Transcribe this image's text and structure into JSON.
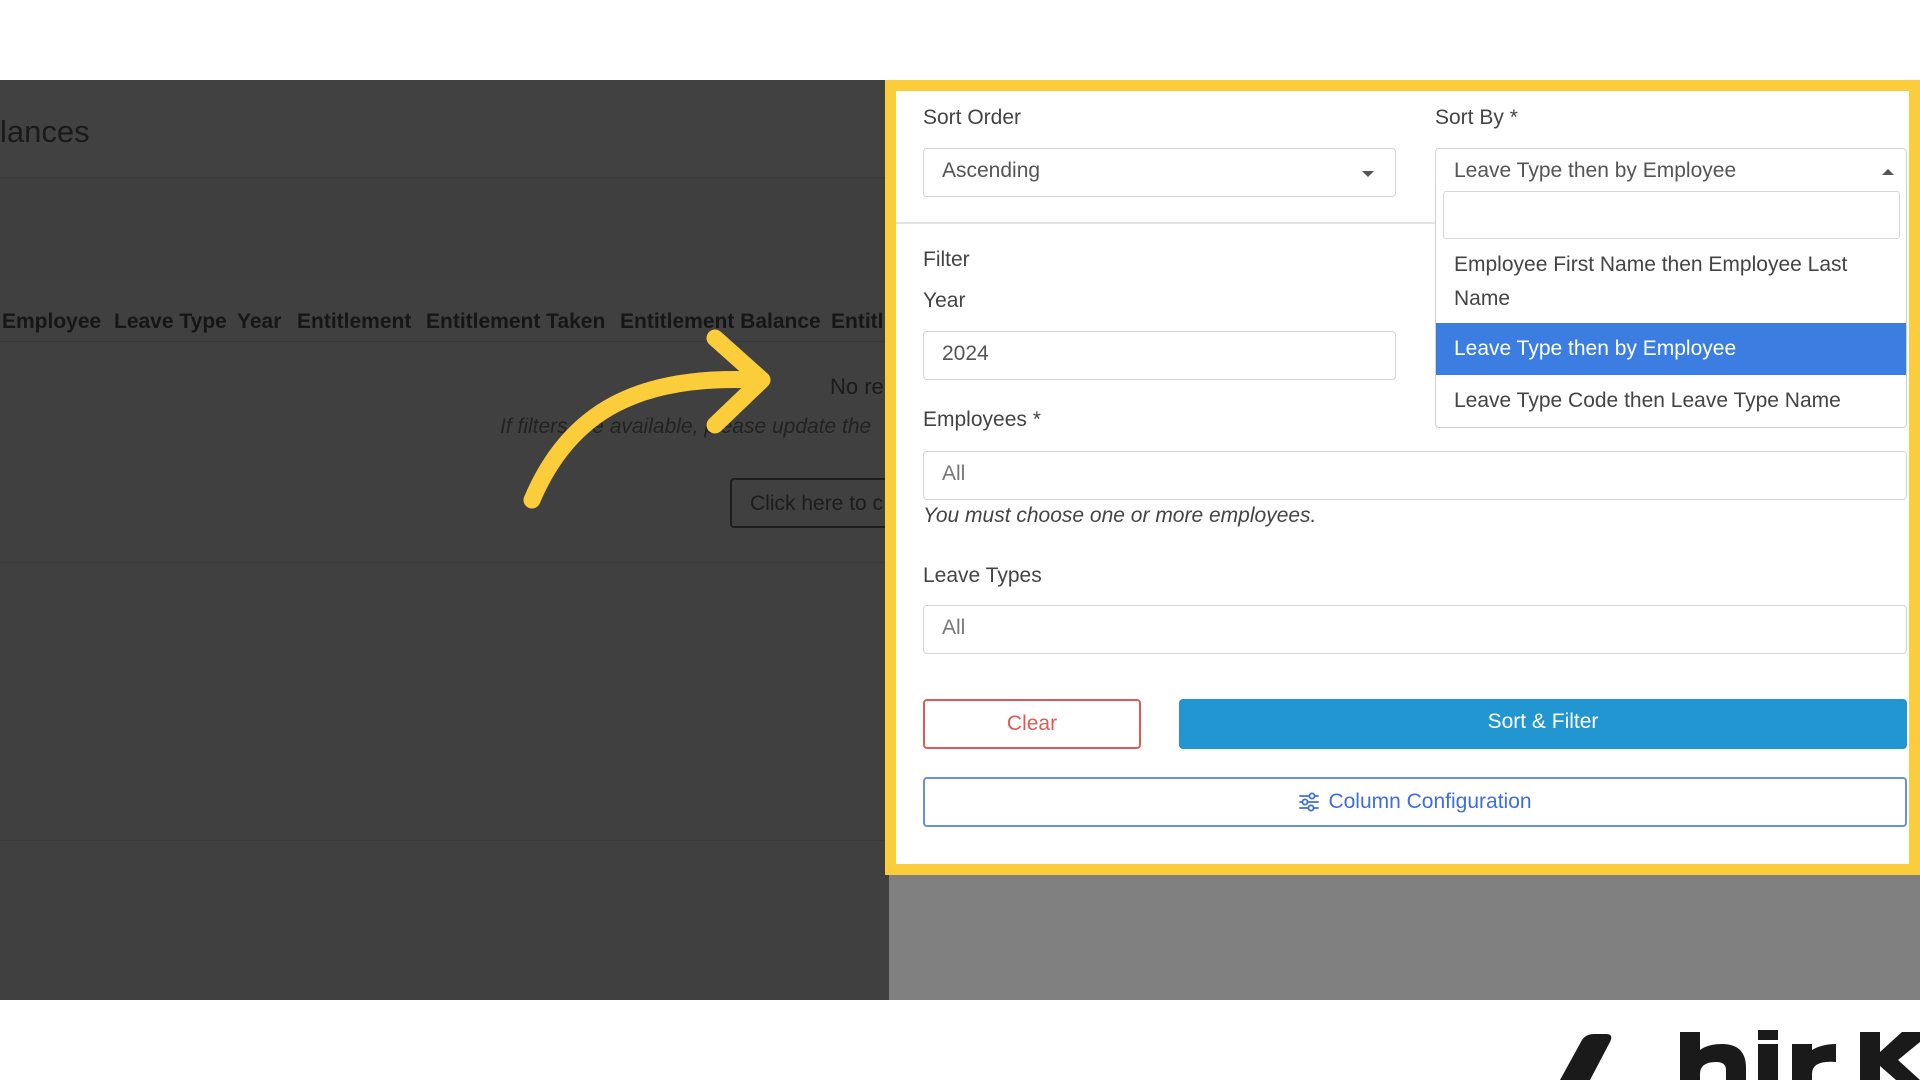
{
  "background_page": {
    "title": "lances",
    "columns": [
      "Employee",
      "Leave Type",
      "Year",
      "Entitlement",
      "Entitlement Taken",
      "Entitlement Balance",
      "Entitl"
    ],
    "empty_title": "No re",
    "empty_hint": "If filters are available, please update the",
    "config_button": "Click here to c"
  },
  "sort": {
    "order_label": "Sort Order",
    "order_value": "Ascending",
    "by_label": "Sort By *",
    "by_value": "Leave Type then by Employee",
    "options": [
      {
        "label": "Employee First Name then Employee Last Name",
        "selected": false
      },
      {
        "label": "Leave Type then by Employee",
        "selected": true
      },
      {
        "label": "Leave Type Code then Leave Type Name",
        "selected": false
      }
    ]
  },
  "filter": {
    "section_label": "Filter",
    "year_label": "Year",
    "year_value": "2024",
    "employees_label": "Employees *",
    "employees_placeholder": "All",
    "employees_hint": "You must choose one or more employees.",
    "leave_types_label": "Leave Types",
    "leave_types_placeholder": "All"
  },
  "actions": {
    "clear_label": "Clear",
    "sort_filter_label": "Sort & Filter",
    "column_config_label": "Column Configuration"
  },
  "colors": {
    "highlight": "#fbcd3a",
    "primary": "#2196d1",
    "danger": "#e05a55",
    "selected_option": "#3b7de0"
  },
  "icons": {
    "arrow": "curved-arrow-icon",
    "column_config": "sliders-icon",
    "dropdown": "chevron-down-icon"
  }
}
